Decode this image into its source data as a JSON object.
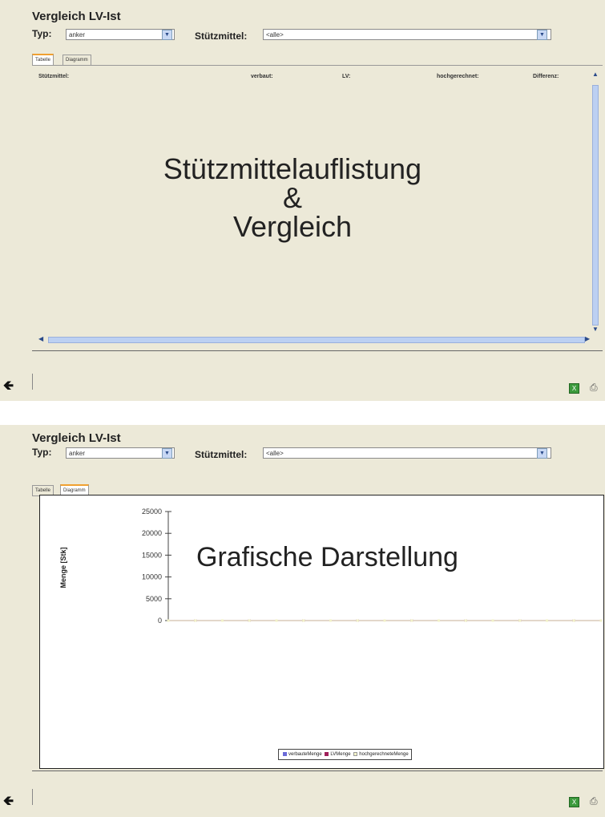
{
  "top": {
    "title": "Vergleich LV-Ist",
    "typ_label": "Typ:",
    "typ_value": "anker",
    "stuetz_label": "Stützmittel:",
    "stuetz_value": "<alle>",
    "tabs": [
      "Tabelle",
      "Diagramm"
    ],
    "active_tab": "Tabelle",
    "columns": [
      "Stützmittel:",
      "verbaut:",
      "LV:",
      "hochgerechnet:",
      "Differenz:"
    ],
    "overlay_lines": [
      "Stützmittelauflistung",
      "&",
      "Vergleich"
    ]
  },
  "bottom": {
    "title": "Vergleich LV-Ist",
    "typ_label": "Typ:",
    "typ_value": "anker",
    "stuetz_label": "Stützmittel:",
    "stuetz_value": "<alle>",
    "tabs": [
      "Tabelle",
      "Diagramm"
    ],
    "active_tab": "Diagramm",
    "overlay": "Grafische Darstellung"
  },
  "icons": {
    "back": "back-arrow-icon",
    "excel": "excel-export-icon",
    "print": "print-icon"
  },
  "chart_data": {
    "type": "line",
    "ylabel": "Menge [Stk]",
    "ylim": [
      0,
      25000
    ],
    "yticks": [
      "25000",
      "20000",
      "15000",
      "10000",
      "5000",
      "0"
    ],
    "series": [
      {
        "name": "verbauteMenge",
        "color": "#6a6ad8",
        "values": [
          0,
          0,
          0,
          0,
          0,
          0,
          0,
          0,
          0,
          0,
          0,
          0,
          0,
          0,
          0,
          0,
          0
        ]
      },
      {
        "name": "LVMenge",
        "color": "#a0205a",
        "values": [
          0,
          0,
          0,
          0,
          0,
          0,
          0,
          0,
          0,
          0,
          0,
          0,
          0,
          0,
          0,
          0,
          0
        ]
      },
      {
        "name": "hochgerechneteMenge",
        "color": "#f2f2c8",
        "values": [
          0,
          0,
          0,
          0,
          0,
          0,
          0,
          0,
          0,
          0,
          0,
          0,
          0,
          0,
          0,
          0,
          0
        ]
      }
    ]
  }
}
